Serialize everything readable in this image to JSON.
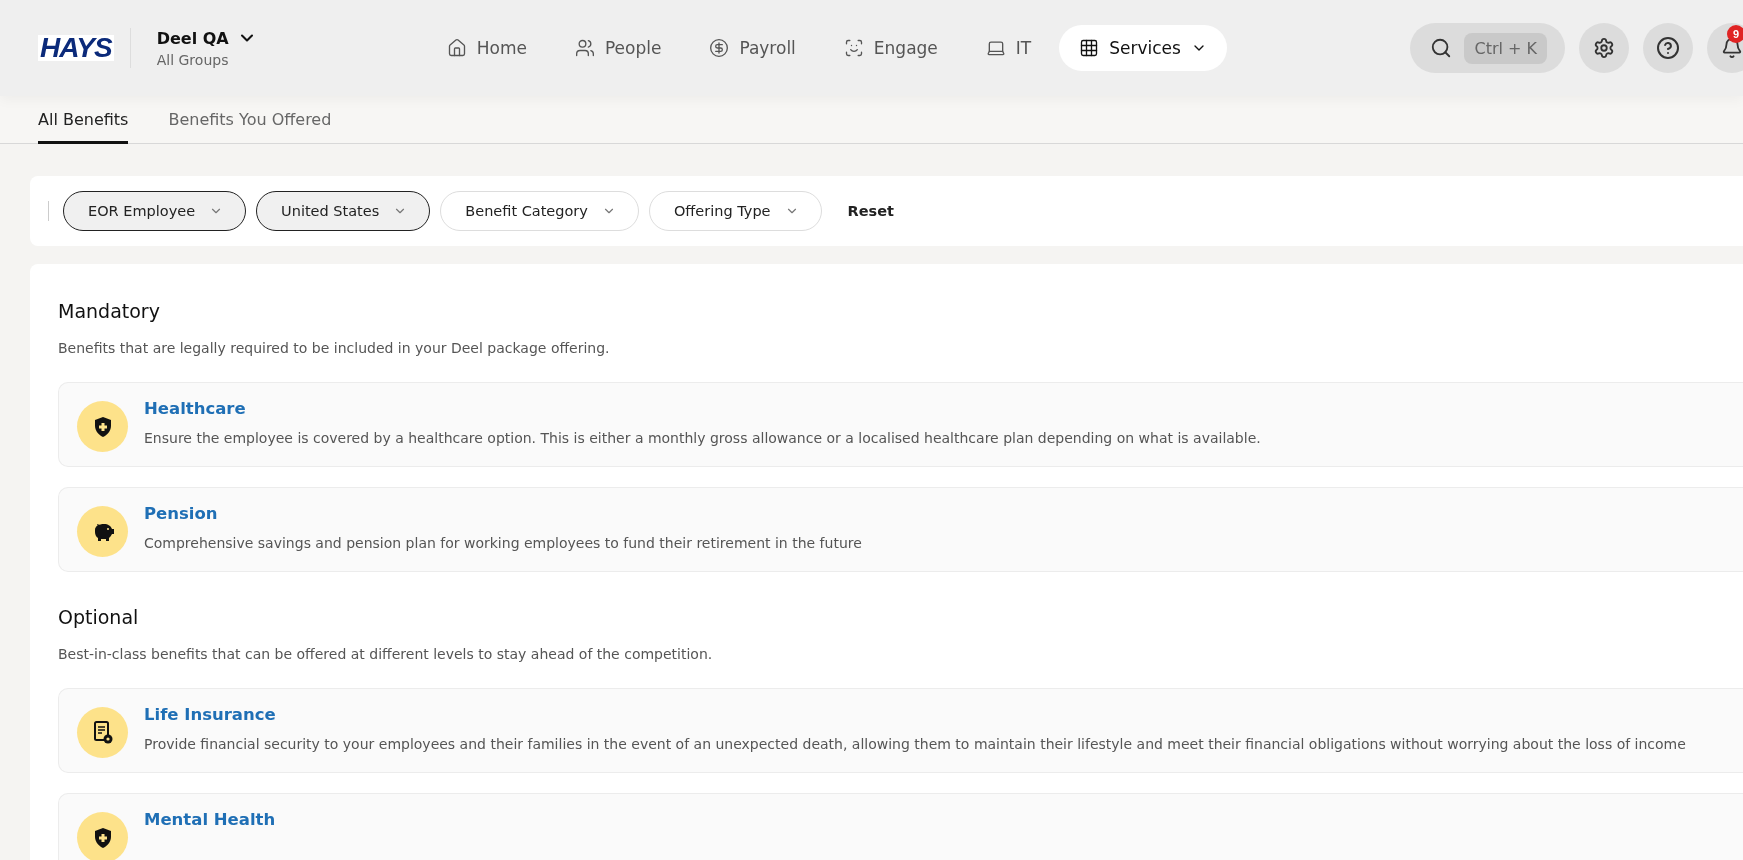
{
  "header": {
    "logo": "HAYS",
    "org": {
      "name": "Deel QA",
      "subtitle": "All Groups"
    },
    "nav": [
      {
        "label": "Home",
        "selected": false
      },
      {
        "label": "People",
        "selected": false
      },
      {
        "label": "Payroll",
        "selected": false
      },
      {
        "label": "Engage",
        "selected": false
      },
      {
        "label": "IT",
        "selected": false
      },
      {
        "label": "Services",
        "selected": true
      }
    ],
    "search": {
      "shortcut": "Ctrl + K"
    },
    "notifications": {
      "badge": "9"
    }
  },
  "tabs": [
    {
      "label": "All Benefits",
      "selected": true
    },
    {
      "label": "Benefits You Offered",
      "selected": false
    }
  ],
  "filters": [
    {
      "label": "EOR Employee",
      "selected": true
    },
    {
      "label": "United States",
      "selected": true
    },
    {
      "label": "Benefit Category",
      "selected": false
    },
    {
      "label": "Offering Type",
      "selected": false
    }
  ],
  "reset": "Reset",
  "sections": [
    {
      "title": "Mandatory",
      "description": "Benefits that are legally required to be included in your Deel package offering.",
      "items": [
        {
          "title": "Healthcare",
          "description": "Ensure the employee is covered by a healthcare option. This is either a monthly gross allowance or a localised healthcare plan depending on what is available."
        },
        {
          "title": "Pension",
          "description": "Comprehensive savings and pension plan for working employees to fund their retirement in the future"
        }
      ]
    },
    {
      "title": "Optional",
      "description": "Best-in-class benefits that can be offered at different levels to stay ahead of the competition.",
      "items": [
        {
          "title": "Life Insurance",
          "description": "Provide financial security to your employees and their families in the event of an unexpected death, allowing them to maintain their lifestyle and meet their financial obligations without worrying about the loss of income"
        },
        {
          "title": "Mental Health"
        }
      ]
    }
  ]
}
